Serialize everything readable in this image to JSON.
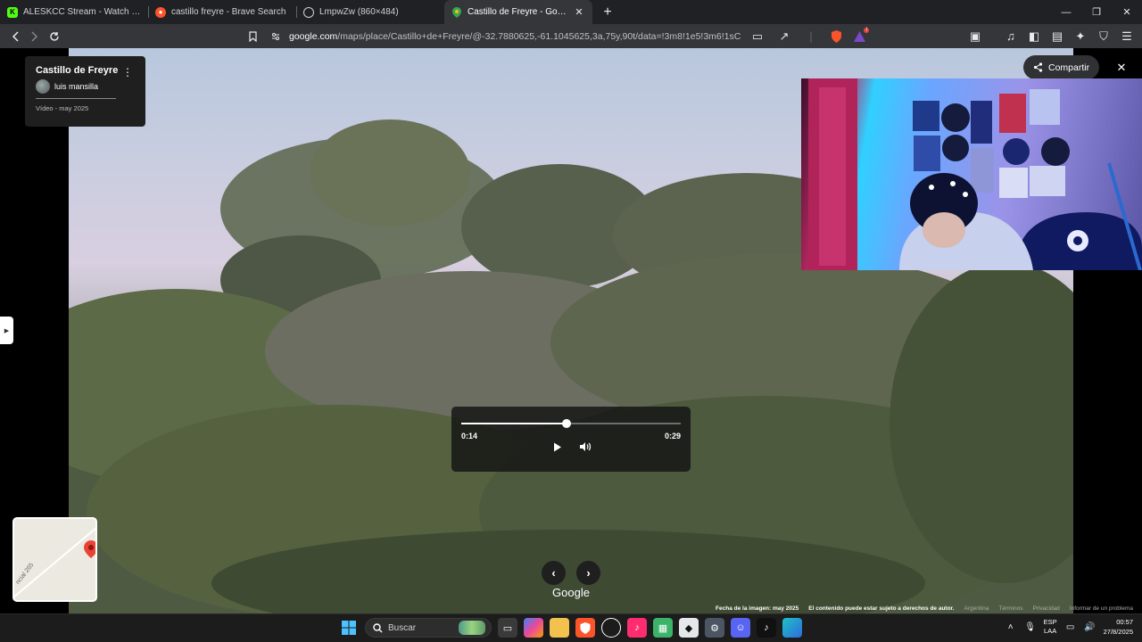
{
  "browser": {
    "tabs": [
      {
        "title": "ALESKCC Stream - Watch Live on Kick",
        "icon": "kick-icon",
        "active": false
      },
      {
        "title": "castillo freyre - Brave Search",
        "icon": "brave-search-icon",
        "active": false
      },
      {
        "title": "LmpwZw (860×484)",
        "icon": "globe-icon",
        "active": false
      },
      {
        "title": "Castillo de Freyre - Google Maps",
        "icon": "google-maps-icon",
        "active": true
      }
    ],
    "new_tab": "+",
    "url_host": "google.com",
    "url_rest": "/maps/place/Castillo+de+Freyre/@-32.7880625,-61.1045625,3a,75y,90t/data=!3m8!1e5!3m6!1sCIABIhAW5sNfJBvJa9IF0AKv4Ymfl2e..."
  },
  "maps": {
    "place_title": "Castillo de Freyre",
    "author": "luis mansilla",
    "caption": "Vídeo - may 2025",
    "share_label": "Compartir",
    "logo": "Google",
    "minimap_road_label": "ncial 265",
    "video": {
      "current_time": "0:14",
      "duration": "0:29",
      "progress": 0.48
    },
    "footer": {
      "image_date": "Fecha de la imagen: may 2025",
      "copyright": "El contenido puede estar sujeto a derechos de autor.",
      "country": "Argentina",
      "terms": "Términos",
      "privacy": "Privacidad",
      "report": "Informar de un problema"
    }
  },
  "taskbar": {
    "search_placeholder": "Buscar",
    "lang_line1": "ESP",
    "lang_line2": "LAA",
    "time": "00:57",
    "date": "27/8/2025"
  },
  "colors": {
    "maps_pin": "#ea4335",
    "kick_green": "#53fc18",
    "brave_orange": "#fb542b"
  }
}
